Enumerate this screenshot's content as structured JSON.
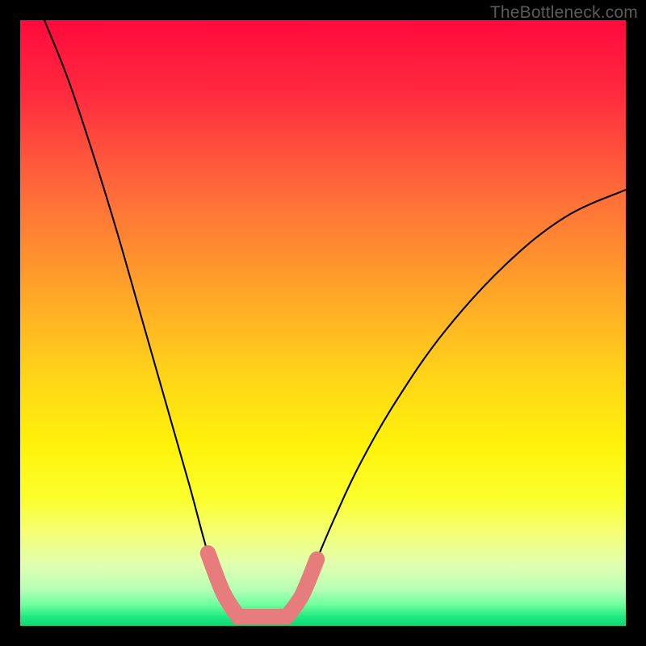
{
  "watermark": "TheBottleneck.com",
  "chart_data": {
    "type": "line",
    "title": "",
    "xlabel": "",
    "ylabel": "",
    "xlim": [
      0,
      100
    ],
    "ylim": [
      0,
      100
    ],
    "axes_visible": false,
    "grid": false,
    "background_gradient_stops": [
      {
        "pos": 0.0,
        "color": "#ff0a3c"
      },
      {
        "pos": 0.12,
        "color": "#ff2a3f"
      },
      {
        "pos": 0.28,
        "color": "#ff6a3a"
      },
      {
        "pos": 0.44,
        "color": "#ffa229"
      },
      {
        "pos": 0.58,
        "color": "#ffd21a"
      },
      {
        "pos": 0.7,
        "color": "#fff20a"
      },
      {
        "pos": 0.79,
        "color": "#fbff2c"
      },
      {
        "pos": 0.85,
        "color": "#f3ff7a"
      },
      {
        "pos": 0.9,
        "color": "#e0ffb0"
      },
      {
        "pos": 0.94,
        "color": "#b6ffb6"
      },
      {
        "pos": 0.965,
        "color": "#6fff9e"
      },
      {
        "pos": 0.985,
        "color": "#20e981"
      },
      {
        "pos": 1.0,
        "color": "#0fd874"
      }
    ],
    "series": [
      {
        "name": "bottleneck-curve",
        "style": "thin-black",
        "x": [
          4.0,
          8.0,
          12.0,
          16.0,
          20.0,
          24.0,
          28.0,
          31.0,
          33.5,
          36.0,
          44.0,
          46.5,
          49.0,
          52.0,
          56.0,
          62.0,
          70.0,
          80.0,
          90.0,
          100.0
        ],
        "values": [
          100.0,
          90.0,
          78.0,
          65.0,
          51.0,
          37.0,
          23.0,
          12.0,
          5.5,
          1.5,
          1.5,
          5.0,
          11.0,
          18.0,
          26.5,
          37.0,
          48.5,
          59.5,
          67.5,
          72.0
        ]
      },
      {
        "name": "highlight-left",
        "style": "thick-salmon",
        "x": [
          31.0,
          33.5,
          36.0
        ],
        "values": [
          12.0,
          5.5,
          1.5
        ]
      },
      {
        "name": "highlight-bottom",
        "style": "thick-salmon",
        "x": [
          36.0,
          40.0,
          44.0
        ],
        "values": [
          1.5,
          1.5,
          1.5
        ]
      },
      {
        "name": "highlight-right",
        "style": "thick-salmon",
        "x": [
          44.0,
          46.5,
          49.0
        ],
        "values": [
          1.5,
          5.0,
          11.0
        ]
      }
    ],
    "annotations": []
  }
}
